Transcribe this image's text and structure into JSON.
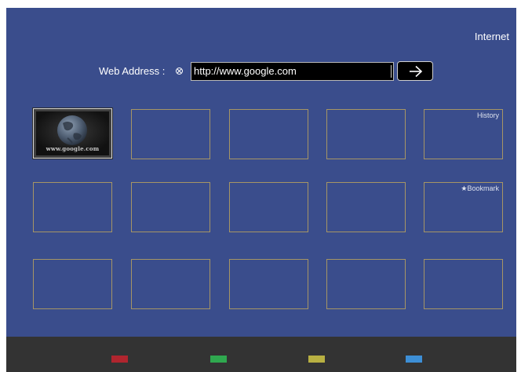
{
  "header": {
    "app_title": "Internet"
  },
  "address_bar": {
    "label": "Web Address :",
    "clear_icon": "clear-circle-x-icon",
    "url_value": "http://www.google.com",
    "go_icon": "arrow-right-icon"
  },
  "tiles": [
    {
      "label": "",
      "thumbnail_text": "www.google.com",
      "active": true
    },
    {
      "label": ""
    },
    {
      "label": ""
    },
    {
      "label": ""
    },
    {
      "label": "History"
    },
    {
      "label": ""
    },
    {
      "label": ""
    },
    {
      "label": ""
    },
    {
      "label": ""
    },
    {
      "label": "★Bookmark"
    },
    {
      "label": ""
    },
    {
      "label": ""
    },
    {
      "label": ""
    },
    {
      "label": ""
    },
    {
      "label": ""
    }
  ],
  "color_keys": [
    {
      "name": "red",
      "color": "#b0252e"
    },
    {
      "name": "green",
      "color": "#2fa84f"
    },
    {
      "name": "yellow",
      "color": "#b8b042"
    },
    {
      "name": "blue",
      "color": "#3d8fd6"
    }
  ],
  "colors": {
    "background": "#3a4d8c",
    "tile_border": "#a69565",
    "bottom_bar": "#333333"
  }
}
